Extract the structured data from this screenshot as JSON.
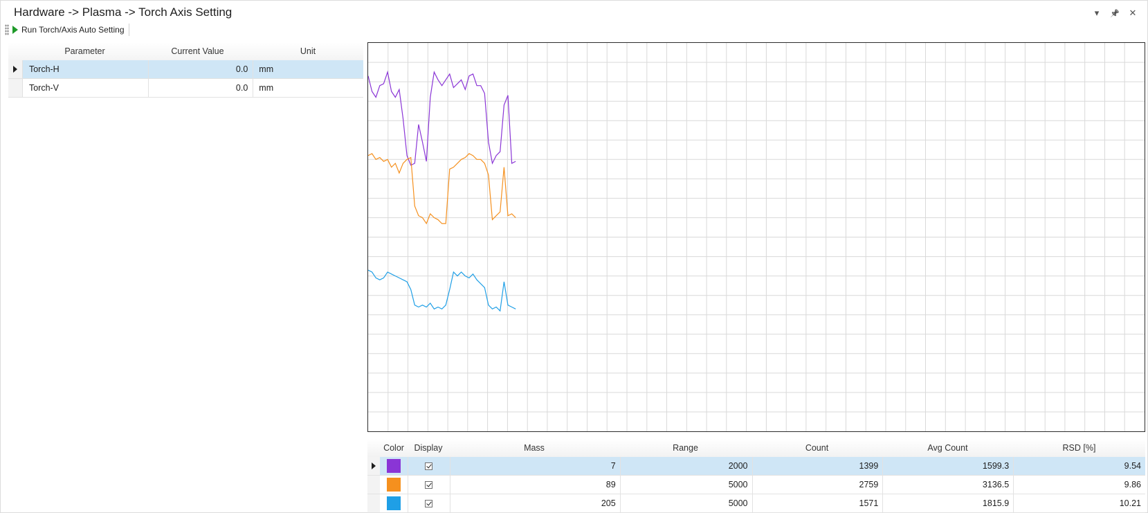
{
  "window": {
    "title": "Hardware -> Plasma -> Torch Axis Setting",
    "controls": [
      "▾",
      "📌",
      "✕"
    ]
  },
  "toolbar": {
    "run_label": "Run Torch/Axis Auto Setting",
    "run_icon": "play-icon"
  },
  "param_table": {
    "headers": {
      "parameter": "Parameter",
      "current_value": "Current Value",
      "unit": "Unit"
    },
    "rows": [
      {
        "parameter": "Torch-H",
        "current_value": "0.0",
        "unit": "mm",
        "selected": true
      },
      {
        "parameter": "Torch-V",
        "current_value": "0.0",
        "unit": "mm",
        "selected": false
      }
    ]
  },
  "chart_data": {
    "type": "line",
    "grid": true,
    "x_points_shown": 39,
    "x_capacity": 200,
    "ylim": [
      0,
      20
    ],
    "series": [
      {
        "color": "#8a35d6",
        "values": [
          18.3,
          17.5,
          17.2,
          17.8,
          17.9,
          18.5,
          17.5,
          17.2,
          17.6,
          16.1,
          14.2,
          13.7,
          13.8,
          15.8,
          14.9,
          13.9,
          17.2,
          18.5,
          18.1,
          17.8,
          18.1,
          18.4,
          17.7,
          17.9,
          18.1,
          17.6,
          18.3,
          18.4,
          17.8,
          17.8,
          17.4,
          14.9,
          13.8,
          14.2,
          14.4,
          16.8,
          17.3,
          13.8,
          13.9
        ]
      },
      {
        "color": "#f5901e",
        "values": [
          14.2,
          14.3,
          14.0,
          14.1,
          13.9,
          14.0,
          13.6,
          13.8,
          13.3,
          13.8,
          14.0,
          14.1,
          11.6,
          11.1,
          11.0,
          10.7,
          11.2,
          11.0,
          10.9,
          10.7,
          10.7,
          13.5,
          13.6,
          13.8,
          14.0,
          14.1,
          14.3,
          14.2,
          14.0,
          14.0,
          13.8,
          13.2,
          10.9,
          11.1,
          11.3,
          13.6,
          11.1,
          11.2,
          11.0
        ]
      },
      {
        "color": "#1f9fe6",
        "values": [
          8.3,
          8.2,
          7.9,
          7.8,
          7.9,
          8.2,
          8.1,
          8.0,
          7.9,
          7.8,
          7.7,
          7.3,
          6.5,
          6.4,
          6.5,
          6.4,
          6.6,
          6.3,
          6.4,
          6.3,
          6.5,
          7.3,
          8.2,
          8.0,
          8.2,
          8.0,
          7.9,
          8.1,
          7.8,
          7.6,
          7.4,
          6.5,
          6.3,
          6.4,
          6.2,
          7.7,
          6.5,
          6.4,
          6.3
        ]
      }
    ]
  },
  "mass_table": {
    "headers": {
      "color": "Color",
      "display": "Display",
      "mass": "Mass",
      "range": "Range",
      "count": "Count",
      "avg_count": "Avg Count",
      "rsd": "RSD [%]"
    },
    "rows": [
      {
        "color": "#8a35d6",
        "display": true,
        "mass": "7",
        "range": "2000",
        "count": "1399",
        "avg_count": "1599.3",
        "rsd": "9.54",
        "selected": true
      },
      {
        "color": "#f5901e",
        "display": true,
        "mass": "89",
        "range": "5000",
        "count": "2759",
        "avg_count": "3136.5",
        "rsd": "9.86",
        "selected": false
      },
      {
        "color": "#1f9fe6",
        "display": true,
        "mass": "205",
        "range": "5000",
        "count": "1571",
        "avg_count": "1815.9",
        "rsd": "10.21",
        "selected": false
      }
    ]
  }
}
